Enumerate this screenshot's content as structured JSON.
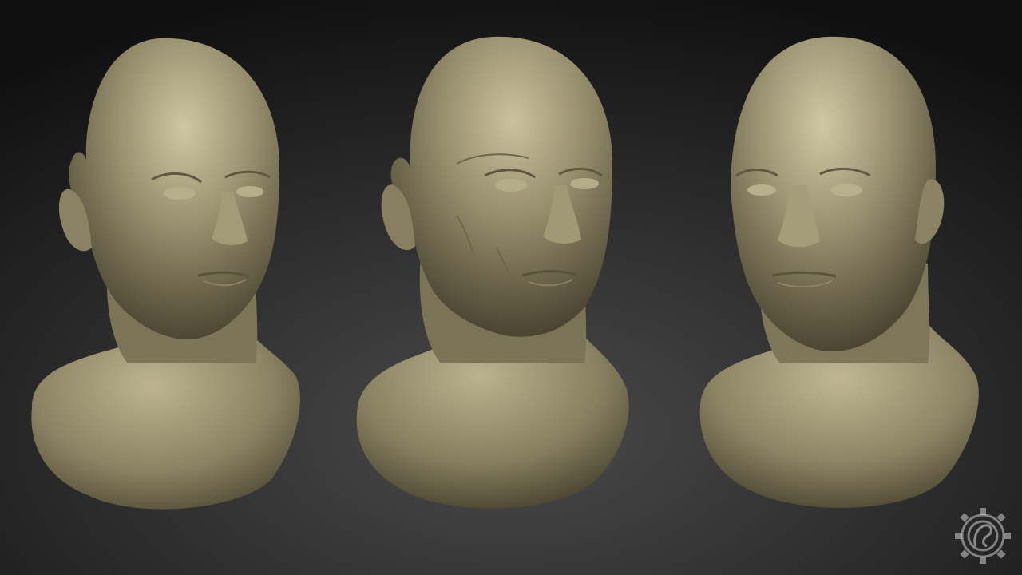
{
  "scene": {
    "description_kind": "3d-render",
    "busts": [
      {
        "id": "bust-1",
        "label": "",
        "skin_tone": "#8f8766",
        "age": "young"
      },
      {
        "id": "bust-2",
        "label": "",
        "skin_tone": "#8d8564",
        "age": "older"
      },
      {
        "id": "bust-3",
        "label": "",
        "skin_tone": "#918969",
        "age": "young"
      }
    ],
    "background": {
      "top": "#111111",
      "bottom": "#3a3a3a"
    },
    "watermark": {
      "icon": "gear-emblem-icon",
      "color": "#cfcfcf"
    }
  }
}
